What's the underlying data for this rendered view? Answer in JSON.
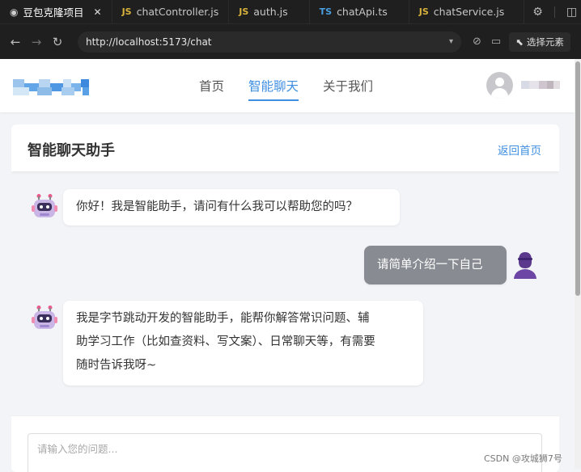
{
  "browser": {
    "tabs": [
      {
        "icon": "eye-icon",
        "label": "豆包克隆项目",
        "active": true
      },
      {
        "lang": "JS",
        "label": "chatController.js"
      },
      {
        "lang": "JS",
        "label": "auth.js"
      },
      {
        "lang": "TS",
        "label": "chatApi.ts"
      },
      {
        "lang": "JS",
        "label": "chatService.js"
      }
    ],
    "url": "http://localhost:5173/chat",
    "select_element_label": "选择元素"
  },
  "header": {
    "nav": [
      {
        "label": "首页",
        "active": false
      },
      {
        "label": "智能聊天",
        "active": true
      },
      {
        "label": "关于我们",
        "active": false
      }
    ]
  },
  "chat": {
    "title": "智能聊天助手",
    "back_label": "返回首页",
    "messages": [
      {
        "role": "assistant",
        "text": "你好！我是智能助手，请问有什么我可以帮助您的吗？"
      },
      {
        "role": "user",
        "text": "请简单介绍一下自己"
      },
      {
        "role": "assistant",
        "lines": [
          "我是字节跳动开发的智能助手，能帮你解答常识问题、辅",
          "助学习工作（比如查资料、写文案）、日常聊天等，有需要",
          "随时告诉我呀~"
        ]
      }
    ],
    "input_placeholder": "请输入您的问题..."
  },
  "watermark": "CSDN @攻城狮7号",
  "colors": {
    "accent": "#3f8fe0",
    "user_bubble": "#888c92",
    "browser_chrome": "#1f1f1f"
  }
}
